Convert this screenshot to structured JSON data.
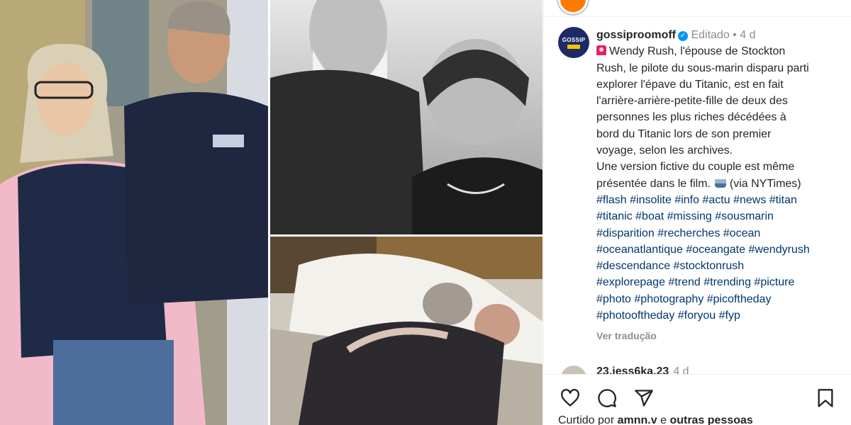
{
  "post": {
    "username": "gossiproomoff",
    "edited_label": "Editado",
    "separator": "•",
    "time_ago": "4 d",
    "avatar_text": "GOSSIP",
    "caption_lines": [
      "Wendy Rush, l'épouse de Stockton",
      "Rush, le pilote du sous-marin disparu parti",
      "explorer l'épave du Titanic, est en fait",
      "l'arrière-arrière-petite-fille de deux des",
      "personnes les plus riches décédées à",
      "bord du Titanic lors de son premier",
      "voyage, selon les archives.",
      "Une version fictive du couple est même",
      "présentée dans le film."
    ],
    "caption_source": "(via NYTimes)",
    "hashtag_lines": [
      [
        "#flash",
        "#insolite",
        "#info",
        "#actu",
        "#news",
        "#titan"
      ],
      [
        "#titanic",
        "#boat",
        "#missing",
        "#sousmarin"
      ],
      [
        "#disparition",
        "#recherches",
        "#ocean"
      ],
      [
        "#oceanatlantique",
        "#oceangate",
        "#wendyrush"
      ],
      [
        "#descendance",
        "#stocktonrush"
      ],
      [
        "#explorepage",
        "#trend",
        "#trending",
        "#picture"
      ],
      [
        "#photo",
        "#photography",
        "#picoftheday"
      ],
      [
        "#photooftheday",
        "#foryou",
        "#fyp"
      ]
    ],
    "see_translation": "Ver tradução"
  },
  "comment": {
    "username": "23.jess6ka.23",
    "time_ago": "4 d"
  },
  "likes": {
    "prefix": "Curtido por",
    "user": "amnn.v",
    "conjunction": "e",
    "others": "outras pessoas"
  },
  "icons": [
    "heart-icon",
    "comment-icon",
    "share-icon",
    "bookmark-icon",
    "verified-icon",
    "siren-emoji",
    "ship-emoji"
  ],
  "colors": {
    "text": "#262626",
    "muted": "#8e8e8e",
    "hashtag": "#00376b",
    "verified": "#0095f6",
    "avatar_bg": "#1d2a66",
    "avatar_accent": "#f3c400"
  }
}
